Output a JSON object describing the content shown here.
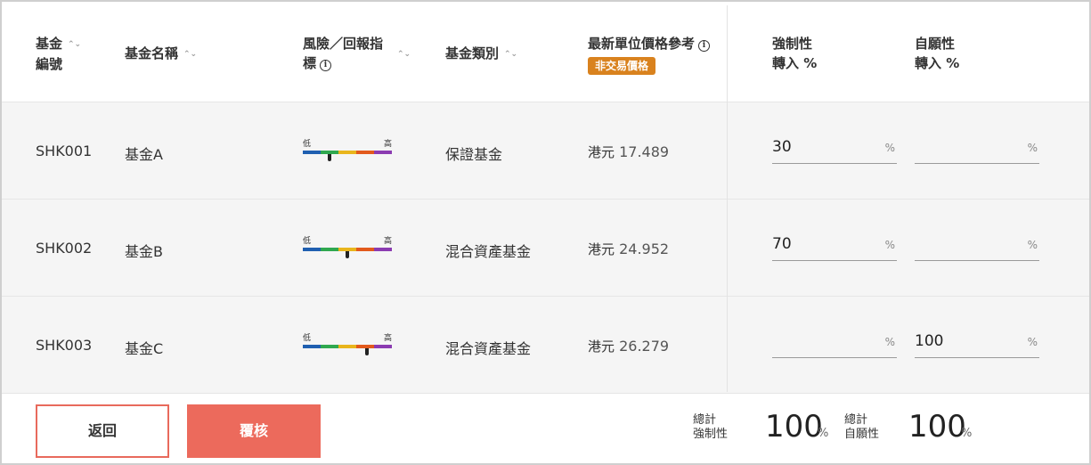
{
  "header": {
    "fund_code": [
      "基金",
      "編號"
    ],
    "fund_name": "基金名稱",
    "risk": [
      "風險／回報指",
      "標"
    ],
    "category": "基金類別",
    "price_title": "最新單位價格參考",
    "price_badge": "非交易價格",
    "mandatory": [
      "強制性",
      "轉入 %"
    ],
    "voluntary": [
      "自願性",
      "轉入 %"
    ],
    "sort_icon": "sort-icon",
    "info_icon": "info-icon"
  },
  "risk_meter": {
    "low_label": "低",
    "high_label": "高",
    "colors": [
      "#1f5fb0",
      "#2fa84f",
      "#e9b51c",
      "#e25a1c",
      "#8b3bb1"
    ]
  },
  "rows": [
    {
      "code": "SHK001",
      "name": "基金A",
      "risk_level": 0.3,
      "category": "保證基金",
      "currency": "港元",
      "price": "17.489",
      "mandatory": "30",
      "voluntary": ""
    },
    {
      "code": "SHK002",
      "name": "基金B",
      "risk_level": 0.5,
      "category": "混合資產基金",
      "currency": "港元",
      "price": "24.952",
      "mandatory": "70",
      "voluntary": ""
    },
    {
      "code": "SHK003",
      "name": "基金C",
      "risk_level": 0.72,
      "category": "混合資產基金",
      "currency": "港元",
      "price": "26.279",
      "mandatory": "",
      "voluntary": "100"
    }
  ],
  "percent_symbol": "%",
  "footer": {
    "back_label": "返回",
    "review_label": "覆核",
    "mandatory_total_label": [
      "總計",
      "強制性"
    ],
    "mandatory_total": "100",
    "voluntary_total_label": [
      "總計",
      "自願性"
    ],
    "voluntary_total": "100"
  },
  "colors": {
    "accent": "#ec6a5c",
    "badge": "#d9821e",
    "row_bg": "#f5f5f5"
  }
}
